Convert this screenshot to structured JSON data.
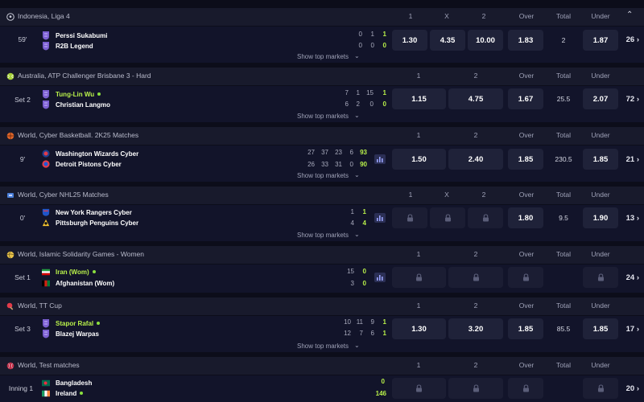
{
  "show_top_label": "Show top markets",
  "sections": [
    {
      "league": "Indonesia, Liga 4",
      "columns": [
        "1",
        "X",
        "2",
        "Over",
        "Total",
        "Under"
      ],
      "status": "59'",
      "teams": [
        {
          "name": "Perssi Sukabumi",
          "scores": [
            "0",
            "1"
          ],
          "total": "1",
          "lead": false,
          "serve": false
        },
        {
          "name": "R2B Legend",
          "scores": [
            "0",
            "0"
          ],
          "total": "0",
          "lead": false,
          "serve": false
        }
      ],
      "odds": [
        "1.30",
        "4.35",
        "10.00",
        "1.83",
        "2",
        "1.87"
      ],
      "more": "26 ›"
    },
    {
      "league": "Australia, ATP Challenger Brisbane 3 - Hard",
      "columns": [
        "1",
        "2",
        "Over",
        "Total",
        "Under"
      ],
      "status": "Set 2",
      "teams": [
        {
          "name": "Tung-Lin Wu",
          "scores": [
            "7",
            "1",
            "15"
          ],
          "total": "1",
          "lead": true,
          "serve": true
        },
        {
          "name": "Christian Langmo",
          "scores": [
            "6",
            "2",
            "0"
          ],
          "total": "0",
          "lead": false,
          "serve": false
        }
      ],
      "odds": [
        "1.15",
        "4.75",
        "1.67",
        "25.5",
        "2.07"
      ],
      "more": "72 ›"
    },
    {
      "league": "World, Cyber Basketball. 2K25 Matches",
      "columns": [
        "1",
        "2",
        "Over",
        "Total",
        "Under"
      ],
      "status": "9'",
      "teams": [
        {
          "name": "Washington Wizards Cyber",
          "scores": [
            "27",
            "37",
            "23",
            "6"
          ],
          "total": "93",
          "lead": false,
          "serve": false
        },
        {
          "name": "Detroit Pistons Cyber",
          "scores": [
            "26",
            "33",
            "31",
            "0"
          ],
          "total": "90",
          "lead": false,
          "serve": false
        }
      ],
      "odds": [
        "1.50",
        "2.40",
        "1.85",
        "230.5",
        "1.85"
      ],
      "more": "21 ›"
    },
    {
      "league": "World, Cyber NHL25 Matches",
      "columns": [
        "1",
        "X",
        "2",
        "Over",
        "Total",
        "Under"
      ],
      "status": "0'",
      "teams": [
        {
          "name": "New York Rangers Cyber",
          "scores": [
            "1"
          ],
          "total": "1",
          "lead": false,
          "serve": false
        },
        {
          "name": "Pittsburgh Penguins Cyber",
          "scores": [
            "4"
          ],
          "total": "4",
          "lead": false,
          "serve": false
        }
      ],
      "odds": [
        "",
        "",
        "",
        "1.80",
        "9.5",
        "1.90"
      ],
      "more": "13 ›"
    },
    {
      "league": "World, Islamic Solidarity Games - Women",
      "columns": [
        "1",
        "2",
        "Over",
        "Total",
        "Under"
      ],
      "status": "Set 1",
      "teams": [
        {
          "name": "Iran (Wom)",
          "scores": [
            "15"
          ],
          "total": "0",
          "lead": true,
          "serve": true
        },
        {
          "name": "Afghanistan (Wom)",
          "scores": [
            "3"
          ],
          "total": "0",
          "lead": false,
          "serve": false
        }
      ],
      "odds": [
        "",
        "",
        "",
        "",
        ""
      ],
      "more": "24 ›"
    },
    {
      "league": "World, TT Cup",
      "columns": [
        "1",
        "2",
        "Over",
        "Total",
        "Under"
      ],
      "status": "Set 3",
      "teams": [
        {
          "name": "Stapor Rafal",
          "scores": [
            "10",
            "11",
            "9"
          ],
          "total": "1",
          "lead": true,
          "serve": true
        },
        {
          "name": "Blazej Warpas",
          "scores": [
            "12",
            "7",
            "6"
          ],
          "total": "1",
          "lead": false,
          "serve": false
        }
      ],
      "odds": [
        "1.30",
        "3.20",
        "1.85",
        "85.5",
        "1.85"
      ],
      "more": "17 ›"
    },
    {
      "league": "World, Test matches",
      "columns": [
        "1",
        "2",
        "Over",
        "Total",
        "Under"
      ],
      "status": "Inning 1",
      "teams": [
        {
          "name": "Bangladesh",
          "scores": [],
          "total": "0",
          "lead": false,
          "serve": false
        },
        {
          "name": "Ireland",
          "scores": [],
          "total": "146",
          "lead": false,
          "serve": true
        }
      ],
      "odds": [
        "",
        "",
        "",
        "",
        ""
      ],
      "more": "20 ›"
    }
  ],
  "colors": {
    "accent_green": "#b8f04a",
    "button_bg": "#1f2239",
    "row_bg": "#12142a",
    "header_bg": "#181a2c"
  }
}
